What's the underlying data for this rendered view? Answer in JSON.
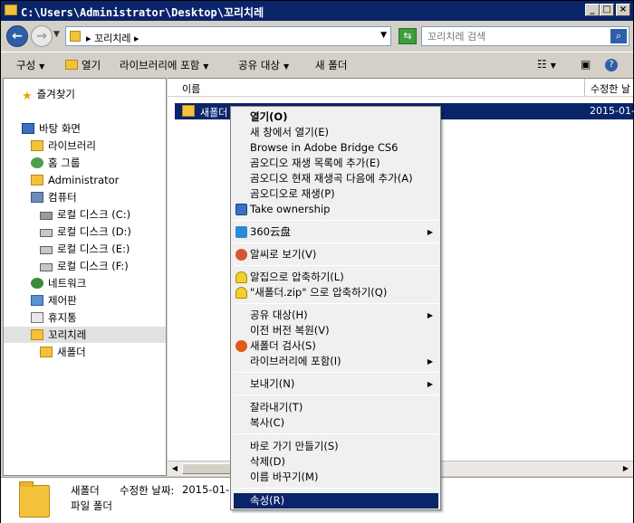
{
  "window": {
    "title": "C:\\Users\\Administrator\\Desktop\\꼬리치레"
  },
  "address": {
    "path": "꼬리치레"
  },
  "search": {
    "placeholder": "꼬리치레 검색"
  },
  "toolbar": {
    "organize": "구성",
    "open": "열기",
    "include_library": "라이브러리에 포함",
    "share": "공유 대상",
    "new_folder": "새 폴더"
  },
  "nav": {
    "favorites": "즐겨찾기",
    "desktop": "바탕 화면",
    "libraries": "라이브러리",
    "homegroup": "홈 그룹",
    "administrator": "Administrator",
    "computer": "컴퓨터",
    "drives": [
      "로컬 디스크 (C:)",
      "로컬 디스크 (D:)",
      "로컬 디스크 (E:)",
      "로컬 디스크 (F:)"
    ],
    "network": "네트워크",
    "control_panel": "제어판",
    "recycle_bin": "휴지통",
    "current_folder": "꼬리치레",
    "sub_folder": "새폴더"
  },
  "columns": {
    "name": "이름",
    "modified": "수정한 날"
  },
  "files": [
    {
      "name": "새폴더",
      "date": "2015-01-"
    }
  ],
  "details": {
    "name": "새폴더",
    "modified_label": "수정한 날짜:",
    "modified_value": "2015-01-0",
    "type": "파일 폴더"
  },
  "context_menu": {
    "open": "열기(O)",
    "open_new_window": "새 창에서 열기(E)",
    "browse_bridge": "Browse in Adobe Bridge CS6",
    "gom_add_playlist": "곰오디오 재생 목록에 추가(E)",
    "gom_add_after": "곰오디오 현재 재생곡 다음에 추가(A)",
    "gom_play": "곰오디오로 재생(P)",
    "take_ownership": "Take ownership",
    "cloud_360": "360云盘",
    "alsee": "알씨로 보기(V)",
    "alzip_compress": "알집으로 압축하기(L)",
    "alzip_compress_named": "\"새폴더.zip\" 으로 압축하기(Q)",
    "share_with": "공유 대상(H)",
    "restore_previous": "이전 버전 복원(V)",
    "scan": "새폴더 검사(S)",
    "include_library": "라이브러리에 포함(I)",
    "send_to": "보내기(N)",
    "cut": "잘라내기(T)",
    "copy": "복사(C)",
    "create_shortcut": "바로 가기 만들기(S)",
    "delete": "삭제(D)",
    "rename": "이름 바꾸기(M)",
    "properties": "속성(R)"
  }
}
